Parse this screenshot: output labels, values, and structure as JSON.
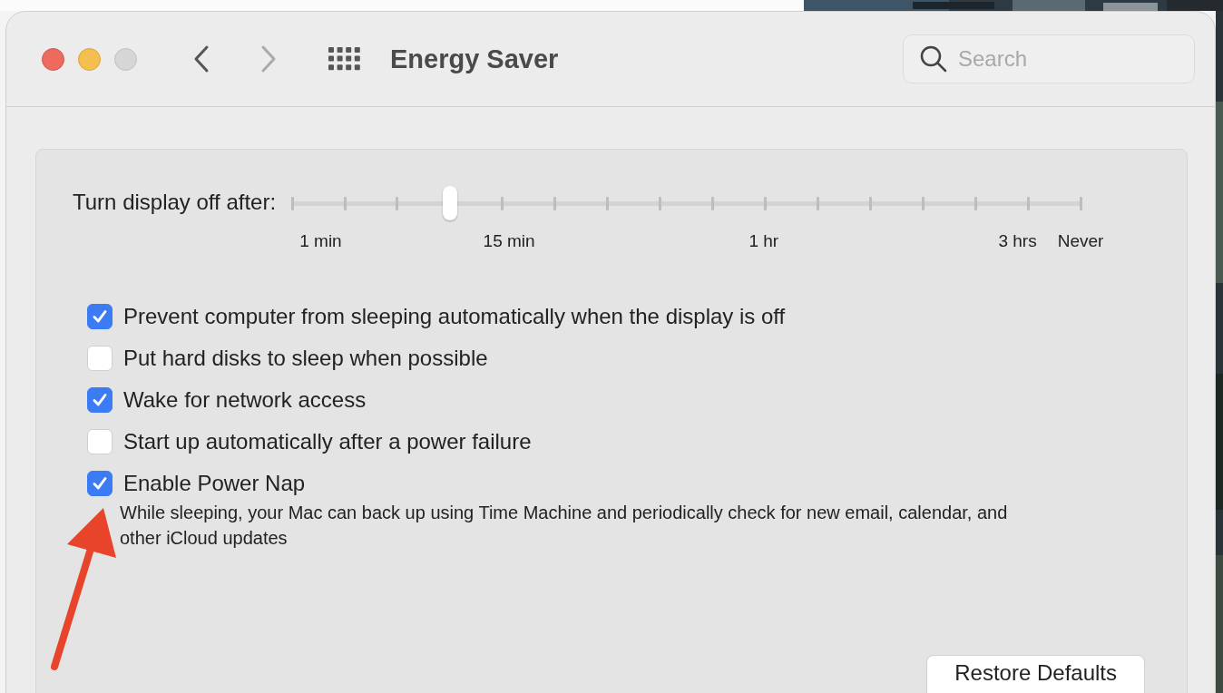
{
  "window": {
    "title": "Energy Saver"
  },
  "search": {
    "placeholder": "Search"
  },
  "display_slider": {
    "label": "Turn display off after:",
    "level": 0.2,
    "tick_labels": [
      "1 min",
      "15 min",
      "1 hr",
      "3 hrs",
      "Never"
    ]
  },
  "options": [
    {
      "label": "Prevent computer from sleeping automatically when the display is off",
      "checked": true
    },
    {
      "label": "Put hard disks to sleep when possible",
      "checked": false
    },
    {
      "label": "Wake for network access",
      "checked": true
    },
    {
      "label": "Start up automatically after a power failure",
      "checked": false
    },
    {
      "label": "Enable Power Nap",
      "checked": true,
      "description": "While sleeping, your Mac can back up using Time Machine and periodically check for new email, calendar, and other iCloud updates"
    }
  ],
  "buttons": [
    "Restore Defaults"
  ]
}
